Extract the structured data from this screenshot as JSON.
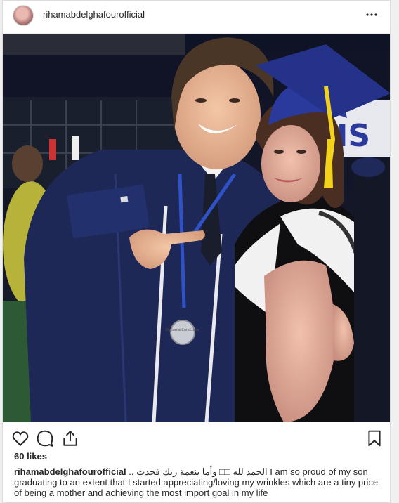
{
  "post": {
    "username": "rihamabdelghafourofficial",
    "likes": "60 likes",
    "caption_user": "rihamabdelghafourofficial",
    "caption_arabic": "الحمد لله □□ وأما بنعمة ربك فحدث ..",
    "caption_text": " I am so proud of my son graduating to an extent that I started appreciating/loving my wrinkles which are a tiny price of being a mother and achieving the most import goal in my life"
  },
  "photo": {
    "medal_text": "Diploma Candidate"
  },
  "icons": {
    "more": "more-options-icon",
    "like": "heart-icon",
    "comment": "comment-icon",
    "share": "share-icon",
    "save": "bookmark-icon"
  },
  "colors": {
    "gown": "#1d2857",
    "cap": "#2a3a9c",
    "tassel": "#f2d21b",
    "text": "#262626"
  }
}
